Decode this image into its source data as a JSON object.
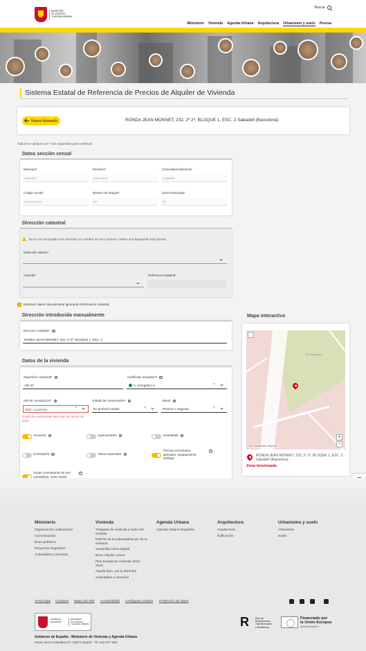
{
  "header": {
    "ministry_lines": [
      "MINISTERIO",
      "DE VIVIENDA",
      "Y AGENDA URBANA"
    ],
    "search_label": "Buscar",
    "nav": [
      "Ministerio",
      "Vivienda",
      "Agenda Urbana",
      "Arquitectura",
      "Urbanismo y suelo",
      "Prensa"
    ]
  },
  "page": {
    "title": "Sistema Estatal de Referencia de Precios de Alquiler de Vivienda",
    "new_search_label": "Nueva búsqueda",
    "address": "RONDA JEAN MONNET, 232, 2º 2ª, BLOQUE 1, ESC. 2 Sabadell (Barcelona)",
    "required_note": "Todos los campos con * son requeridos para continuar"
  },
  "census": {
    "title": "Datos sección censal",
    "municipio_label": "Municipio*",
    "municipio_value": "Sabadell",
    "provincia_label": "Provincia*",
    "provincia_value": "Barcelona",
    "comunidad_label": "Comunidad autónoma*",
    "comunidad_value": "Cataluña",
    "codigo_label": "Código censal*",
    "codigo_value": "0818705013",
    "testigos_label": "Número de testigos*",
    "testigos_value": "80",
    "zona_label": "Zona tensionada*",
    "zona_value": "Sí"
  },
  "cadastral": {
    "title": "Dirección catastral",
    "warning": "No se ha encontrado una vivienda con nombre de vía y número, realice una búsqueda más precisa.",
    "catastro_label": "Datos del catastro*",
    "vivienda_label": "Vivienda*",
    "referencia_label": "Referencia Catastral*"
  },
  "manual_checkbox_label": "Introducir datos manualmente ignorando información catastral",
  "manual": {
    "title": "Dirección introducida manualmente",
    "full_address_label": "Dirección completa*",
    "full_address_value": "RONDA JEAN MONNET, 232, 2º 2ª, BLOQUE 1, ESC. 2"
  },
  "dwelling": {
    "title": "Datos de la vivienda",
    "surface_label": "Superficie construida*",
    "surface_value": "100  m²",
    "energy_label": "Certificado energético*",
    "energy_value": "C. energético A",
    "year_label": "Año de construcción*",
    "year_value": "2021 o posterior",
    "year_error": "El año de construcción tiene que ser menor de 2021",
    "conservation_label": "Estado de conservación*",
    "conservation_value": "En perfecto estado",
    "height_label": "Altura*",
    "height_value": "Primero o segundo",
    "toggles": [
      {
        "label": "Ascensor",
        "on": true
      },
      {
        "label": "Aparcamiento",
        "on": false
      },
      {
        "label": "Amueblada",
        "on": false
      },
      {
        "label": "Conserjería",
        "on": false
      },
      {
        "label": "Vistas especiales",
        "on": false
      },
      {
        "label": "Piscina comunitaria, gimnasio, equipamiento análogo",
        "on": true
      },
      {
        "label": "Zonas comunitarias de uso compartido, como jardín, azotea o salas comunes",
        "on": true
      }
    ]
  },
  "map": {
    "title": "Mapa interactivo",
    "park_label": "Parc del Gas Fou",
    "attribution": "IGN Cartociudad, MapLibre",
    "address": "RONDA JEAN MONNET, 232, 2º 2ª, BLOQUE 1, ESC. 2 Sabadell (Barcelona)",
    "zone": "Zona tensionada",
    "zone_color": "#d0021b"
  },
  "footer": {
    "columns": [
      {
        "title": "Ministerio",
        "links": [
          "Organización institucional",
          "Comunicación",
          "Buen gobierno",
          "Proyectos singulares",
          "Actividades y servicios"
        ]
      },
      {
        "title": "Vivienda",
        "links": [
          "Traspaso de vivienda y suelo del SAREB",
          "PERTE de la industrialización de la vivienda",
          "Ventanilla Única Digital",
          "Bono Alquiler Joven",
          "Plan Estatal de Vivienda 2022-2025",
          "Alquila bien, ¡es tu derecho!",
          "Actividades y servicios"
        ]
      },
      {
        "title": "Agenda Urbana",
        "links": [
          "Agenda Urbana Española"
        ]
      },
      {
        "title": "Arquitectura",
        "links": [
          "Arquitectura",
          "Edificación"
        ]
      },
      {
        "title": "Urbanismo y suelo",
        "links": [
          "Urbanismo",
          "Suelo"
        ]
      }
    ],
    "bottom_links": [
      "Aviso legal",
      "Contacto",
      "Mapa del sitio",
      "Accesibilidad",
      "Configurar cookies",
      "Protección de datos"
    ],
    "gov_text_1": [
      "GOBIERNO",
      "DE ESPAÑA"
    ],
    "gov_text_2": [
      "MINISTERIO",
      "DE VIVIENDA",
      "Y AGENDA URBANA"
    ],
    "gov_line": "Gobierno de España - Ministerio de Vivienda y Agenda Urbana",
    "address_line": "Paseo de la Castellana 67, 28071 Madrid · Tlf. 915 977 000",
    "prtr_lines": [
      "Plan de",
      "Recuperación,",
      "Transformación",
      "y Resiliencia"
    ],
    "eu_lines": [
      "Financiado por",
      "la Unión Europea"
    ],
    "eu_sub": "NextGenerationEU"
  },
  "colors": {
    "accent": "#ffd700",
    "error": "#e05050",
    "energy_dot": "#1a8a3a"
  }
}
